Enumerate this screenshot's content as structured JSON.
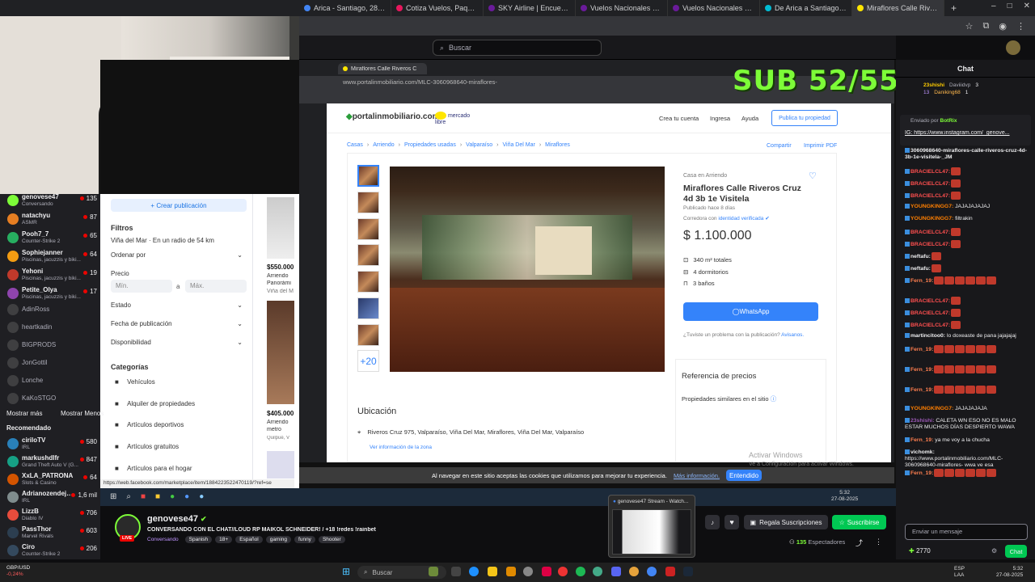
{
  "browser_tabs": [
    {
      "label": "Arica - Santiago, 28/08/2025",
      "color": "#4285f4"
    },
    {
      "label": "Cotiza Vuelos, Paquetes, Hotel",
      "color": "#e8175d"
    },
    {
      "label": "SKY Airline | Encuentra vuelos",
      "color": "#6a1b9a"
    },
    {
      "label": "Vuelos Nacionales con SKY",
      "color": "#6a1b9a"
    },
    {
      "label": "Vuelos Nacionales con SKY",
      "color": "#6a1b9a"
    },
    {
      "label": "De Arica a Santiago de Chile",
      "color": "#00bcd4"
    },
    {
      "label": "Miraflores Calle Riveros Cruz",
      "color": "#ffe600",
      "active": true
    }
  ],
  "twitch": {
    "search_placeholder": "Buscar",
    "sidebar": {
      "live": [
        {
          "name": "genovese47",
          "game": "Conversando",
          "viewers": "135",
          "color": "#7dfc38"
        },
        {
          "name": "natachyu",
          "game": "ASMR",
          "viewers": "87",
          "color": "#e67e22"
        },
        {
          "name": "Pooh7_7",
          "game": "Counter-Strike 2",
          "viewers": "65",
          "color": "#27ae60"
        },
        {
          "name": "Sophiejanner",
          "game": "Piscinas, jacuzzis y biki...",
          "viewers": "64",
          "color": "#f39c12"
        },
        {
          "name": "Yehoni",
          "game": "Piscinas, jacuzzis y biki...",
          "viewers": "19",
          "color": "#c0392b"
        },
        {
          "name": "Petite_Olya",
          "game": "Piscinas, jacuzzis y biki...",
          "viewers": "17",
          "color": "#8e44ad"
        }
      ],
      "offline": [
        "AdinRoss",
        "heartkadin",
        "BIGPRODS",
        "JonGottil",
        "Lonche",
        "KaKoSTGO"
      ],
      "show_more": "Mostrar más",
      "show_less": "Mostrar Menos",
      "recommended_title": "Recomendado",
      "recommended": [
        {
          "name": "ciriloTV",
          "game": "IRL",
          "viewers": "580",
          "color": "#2980b9"
        },
        {
          "name": "markushdlfr",
          "game": "Grand Theft Auto V (G...",
          "viewers": "847",
          "color": "#16a085"
        },
        {
          "name": "XxLA_PATRONA",
          "game": "Slots & Casino",
          "viewers": "64",
          "color": "#d35400"
        },
        {
          "name": "Adrianozendeja...",
          "game": "IRL",
          "viewers": "1,6 mil",
          "color": "#7f8c8d"
        },
        {
          "name": "LizzB",
          "game": "Diablo IV",
          "viewers": "706",
          "color": "#e74c3c"
        },
        {
          "name": "PassThor",
          "game": "Marvel Rivals",
          "viewers": "603",
          "color": "#2c3e50"
        },
        {
          "name": "Ciro",
          "game": "Counter-Strike 2",
          "viewers": "206",
          "color": "#34495e"
        }
      ],
      "forex": {
        "pair": "GBP/USD",
        "change": "-0,24%"
      }
    },
    "channel": {
      "name": "genovese47",
      "title": "CONVERSANDO CON EL CHAT//LOUD RP MAIKOL SCHNEIDER! / +18 !redes !rainbet",
      "category": "Conversando",
      "tags": [
        "Spanish",
        "18+",
        "Español",
        "gaming",
        "funny",
        "Shooter"
      ],
      "live_label": "LIVE",
      "gift_label": "Regala Suscripciones",
      "subscribe_label": "Suscribirse",
      "viewers": "135",
      "viewers_label": "Espectadores"
    },
    "chat": {
      "title": "Chat",
      "top_gifters": [
        {
          "name": "23shishi",
          "count": "13",
          "rank": "3"
        },
        {
          "name": "Daviiidvp",
          "count": "3"
        },
        {
          "name": "Daniking68",
          "count": "1"
        }
      ],
      "sent_by": "Enviado por",
      "sent_user": "BotRix",
      "pinned_link": "IG: https://www.instagram.com/_genove...",
      "messages": [
        {
          "user": "3060968640-miraflores-calle-riveros-cruz-4d-3b-1e-visitela-_JM",
          "text": "",
          "color": "#efeff1",
          "link": true
        },
        {
          "user": "BRACIELCL47:",
          "text": "",
          "color": "#ff4f4f",
          "emotes": 1
        },
        {
          "user": "BRACIELCL47:",
          "text": "",
          "color": "#ff4f4f",
          "emotes": 1
        },
        {
          "user": "BRACIELCL47:",
          "text": "",
          "color": "#ff4f4f",
          "emotes": 1
        },
        {
          "user": "YOUNGKINGG7:",
          "text": "JAJAJAJAJAJ",
          "color": "#ff7f00"
        },
        {
          "user": "YOUNGKINGG7:",
          "text": "filtrakin",
          "color": "#ff7f00"
        },
        {
          "user": "BRACIELCL47:",
          "text": "",
          "color": "#ff4f4f",
          "emotes": 1
        },
        {
          "user": "BRACIELCL47:",
          "text": "",
          "color": "#ff4f4f",
          "emotes": 1
        },
        {
          "user": "neftafu:",
          "text": "",
          "color": "#efeff1",
          "emotes": 1
        },
        {
          "user": "neftafu:",
          "text": "",
          "color": "#efeff1",
          "emotes": 1
        },
        {
          "user": "Fern_19:",
          "text": "",
          "color": "#ff7f50",
          "emotes": 6
        },
        {
          "user": "BRACIELCL47:",
          "text": "",
          "color": "#ff4f4f",
          "emotes": 1
        },
        {
          "user": "BRACIELCL47:",
          "text": "",
          "color": "#ff4f4f",
          "emotes": 1
        },
        {
          "user": "BRACIELCL47:",
          "text": "",
          "color": "#ff4f4f",
          "emotes": 1
        },
        {
          "user": "martincitoo0:",
          "text": "lo doxeaste de pana jajajajaj",
          "color": "#efeff1"
        },
        {
          "user": "Fern_19:",
          "text": "",
          "color": "#ff7f50",
          "emotes": 6
        },
        {
          "user": "Fern_19:",
          "text": "",
          "color": "#ff7f50",
          "emotes": 6
        },
        {
          "user": "Fern_19:",
          "text": "",
          "color": "#ff7f50",
          "emotes": 6
        },
        {
          "user": "YOUNGKINGG7:",
          "text": "JAJAJAJAJA",
          "color": "#ff7f00"
        },
        {
          "user": "23shishi:",
          "text": "CALETA WN ESO NO ES MALO ESTAR MUCHOS DÍAS DESPIERTO WAWA",
          "color": "#9b59b6"
        },
        {
          "user": "Fern_19:",
          "text": "ya me voy a la chucha",
          "color": "#ff7f50"
        },
        {
          "user": "vichomk:",
          "text": "https://www.portalinmobiliario.com/MLC-3060968640-miraflores- wwa ve esa",
          "color": "#efeff1"
        },
        {
          "user": "Fern_19:",
          "text": "",
          "color": "#ff7f50",
          "emotes": 6
        }
      ],
      "input_placeholder": "Enviar un mensaje",
      "points": "2770",
      "send_label": "Chat"
    }
  },
  "stream": {
    "sub_goal": "SUB 52/55",
    "inner_tab": "Miraflores Calle Riveros C",
    "inner_url": "www.portalinmobiliario.com/MLC-3060968640-miraflores-",
    "portal": {
      "logo": "portalinmobiliario.com",
      "partner": "mercado libre",
      "nav": [
        "Crea tu cuenta",
        "Ingresa",
        "Ayuda"
      ],
      "publish": "Publica tu propiedad",
      "breadcrumb": [
        "Casas",
        "Arriendo",
        "Propiedades usadas",
        "Valparaíso",
        "Viña Del Mar",
        "Miraflores"
      ],
      "share": "Compartir",
      "print": "Imprimir PDF",
      "status": "Casa en Arriendo",
      "title": "Miraflores Calle Riveros Cruz 4d 3b 1e Visitela",
      "published": "Publicado hace 8 días",
      "broker": "Corredora con",
      "broker_link": "identidad verificada",
      "price": "$ 1.100.000",
      "features": [
        "340 m² totales",
        "4 dormitorios",
        "3 baños"
      ],
      "whatsapp": "WhatsApp",
      "problem": "¿Tuviste un problema con la publicación?",
      "problem_link": "Avisanos.",
      "thumbs_more": "+20",
      "location_title": "Ubicación",
      "address": "Riveros Cruz 975, Valparaíso, Viña Del Mar, Miraflores, Viña Del Mar, Valparaíso",
      "zone_link": "Ver información de la zona",
      "price_ref_title": "Referencia de precios",
      "similar": "Propiedades similares en el sitio",
      "watermark1": "Activar Windows",
      "watermark2": "Ve a Configuración para activar Windows."
    },
    "listing_panel": {
      "create": "+ Crear publicación",
      "filters": "Filtros",
      "location": "Viña del Mar · En un radio de 54 km",
      "order": "Ordenar por",
      "price": "Precio",
      "min": "Mín.",
      "max": "Máx.",
      "a": "a",
      "state": "Estado",
      "pubdate": "Fecha de publicación",
      "availability": "Disponibilidad",
      "categories": "Categorías",
      "cats": [
        "Vehículos",
        "Alquiler de propiedades",
        "Artículos deportivos",
        "Artículos gratuitos",
        "Artículos para el hogar"
      ],
      "status_url": "https://web.facebook.com/marketplace/item/1884223522470119/?ref=se",
      "cards": [
        {
          "price": "$550.000",
          "l1": "Arriendo",
          "l2": "Panorámi",
          "l3": "Viña del M"
        },
        {
          "price": "$405.000",
          "l1": "Arriendo",
          "l2": "metro",
          "l3": "Quilpué, V"
        }
      ]
    },
    "cookie_text": "Al navegar en este sitio aceptas las cookies que utilizamos para mejorar tu experiencia.",
    "cookie_link": "Más información.",
    "cookie_btn": "Entendido",
    "inner_clock": {
      "time": "5:32",
      "date": "27-08-2025"
    }
  },
  "taskbar": {
    "search": "Buscar",
    "lang1": "ESP",
    "lang2": "LAA",
    "time": "5:32",
    "date": "27-08-2025",
    "popup_title": "genovese47 Stream - Watch..."
  }
}
